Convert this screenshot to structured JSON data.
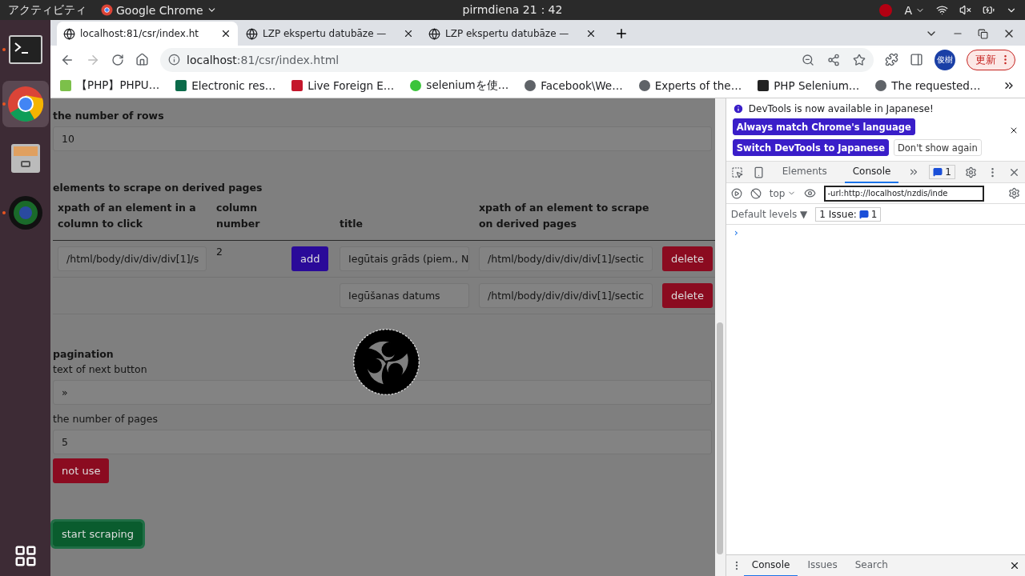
{
  "top_bar": {
    "activities": "アクティビティ",
    "app_menu": "Google Chrome",
    "clock": "pirmdiena 21：42",
    "input_method": "A"
  },
  "dock": {
    "items": [
      {
        "kind": "terminal",
        "running": true,
        "selected": false
      },
      {
        "kind": "chrome",
        "running": true,
        "selected": true
      },
      {
        "kind": "files",
        "running": false,
        "selected": false
      },
      {
        "kind": "camera",
        "running": true,
        "selected": false
      }
    ]
  },
  "tabs": [
    {
      "label": "localhost:81/csr/index.ht",
      "selected": true
    },
    {
      "label": "LZP ekspertu datubāze —",
      "selected": false
    },
    {
      "label": "LZP ekspertu datubāze —",
      "selected": false
    }
  ],
  "address_bar": {
    "host": "localhost",
    "path": ":81/csr/index.html"
  },
  "profile": "俊樹",
  "update_button": "更新",
  "bookmarks": [
    "【PHP】PHPU…",
    "Electronic res…",
    "Live Foreign E…",
    "seleniumを使…",
    "Facebook\\We…",
    "Experts of the…",
    "PHP Selenium…",
    "The requested…"
  ],
  "page": {
    "loading": true,
    "rows_label": "the number of rows",
    "rows_value": "10",
    "derived_heading": "elements to scrape on derived pages",
    "columns": [
      "xpath of an element in a column to click",
      "column number",
      "title",
      "xpath of an element to scrape on derived pages"
    ],
    "click_xpath": "/html/body/div/div/div[1]/s",
    "column_number": "2",
    "add_button": "add",
    "items": [
      {
        "title": "Iegūtais grāds (piem., N",
        "xpath": "/html/body/div/div/div[1]/sectic",
        "delete": "delete"
      },
      {
        "title": "Iegūšanas datums",
        "xpath": "/html/body/div/div/div[1]/sectic",
        "delete": "delete"
      }
    ],
    "pagination_heading": "pagination",
    "next_label": "text of next button",
    "next_value": "»",
    "pages_label": "the number of pages",
    "pages_value": "5",
    "not_use_button": "not use",
    "start_button": "start scraping"
  },
  "devtools": {
    "notice": "DevTools is now available in Japanese!",
    "match_button": "Always match Chrome's language",
    "switch_button": "Switch DevTools to Japanese",
    "dont_show_button": "Don't show again",
    "panels": [
      {
        "label": "Elements",
        "selected": false
      },
      {
        "label": "Console",
        "selected": true
      }
    ],
    "issues_count": "1",
    "context": "top",
    "filter": "-url:http://localhost/nzdis/inde",
    "levels": "Default levels ▼",
    "issue_label": "1 Issue:",
    "issue_count": "1",
    "prompt": "›",
    "drawer_tabs": [
      {
        "label": "Console",
        "selected": true
      },
      {
        "label": "Issues",
        "selected": false
      },
      {
        "label": "Search",
        "selected": false
      }
    ]
  }
}
